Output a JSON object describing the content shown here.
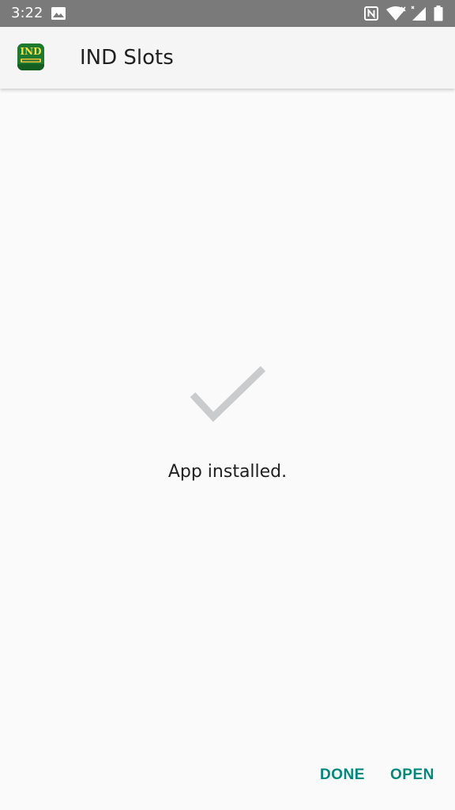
{
  "status_bar": {
    "time": "3:22",
    "icons": [
      "image-notification-icon",
      "nfc-icon",
      "wifi-icon",
      "signal-icon",
      "battery-icon"
    ]
  },
  "app_bar": {
    "app_icon": "ind-slots-app-icon",
    "app_icon_text": "IND",
    "title": "IND Slots"
  },
  "main": {
    "icon": "check-icon",
    "message": "App installed."
  },
  "actions": {
    "done_label": "DONE",
    "open_label": "OPEN"
  },
  "colors": {
    "status_bar": "#7a7a7a",
    "app_bar": "#f5f5f5",
    "background": "#fafafa",
    "accent": "#00897b",
    "check": "#c9cbcd",
    "text": "#212121"
  }
}
